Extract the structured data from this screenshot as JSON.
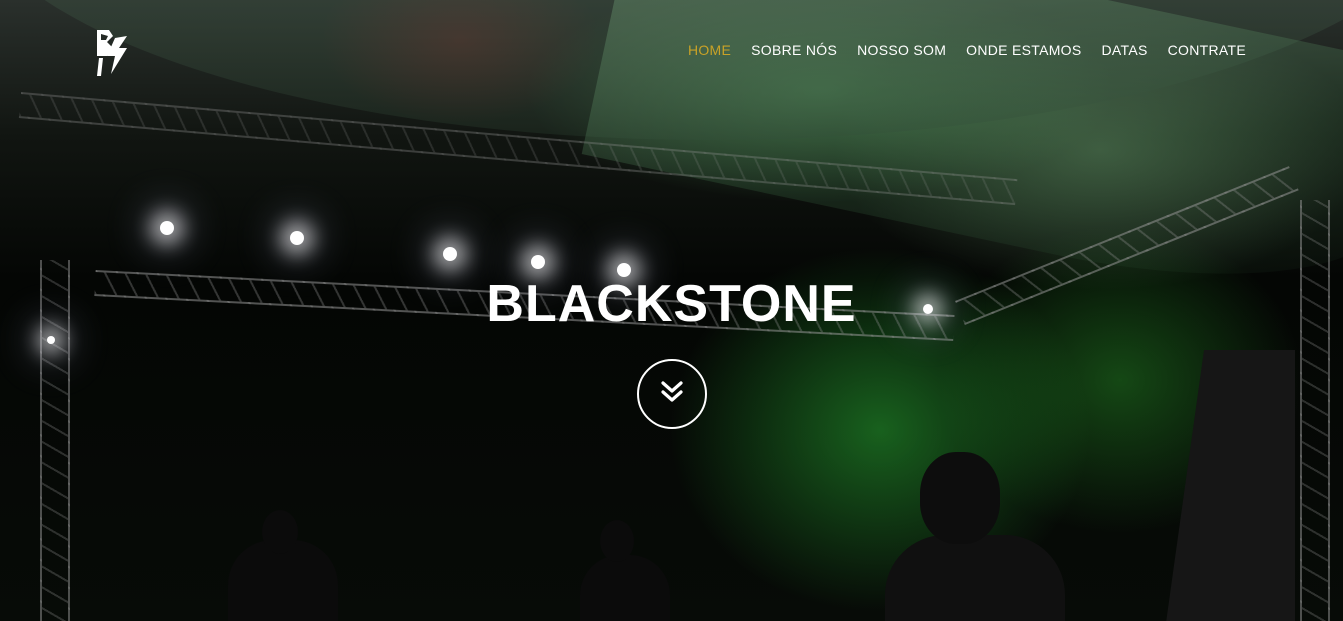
{
  "brand": {
    "logo_icon": "blackstone-lightning-logo"
  },
  "nav": {
    "items": [
      {
        "label": "HOME",
        "active": true
      },
      {
        "label": "SOBRE NÓS",
        "active": false
      },
      {
        "label": "NOSSO SOM",
        "active": false
      },
      {
        "label": "ONDE ESTAMOS",
        "active": false
      },
      {
        "label": "DATAS",
        "active": false
      },
      {
        "label": "CONTRATE",
        "active": false
      }
    ],
    "active_color": "#c9a227",
    "text_color": "#ffffff"
  },
  "hero": {
    "title": "BLACKSTONE",
    "scroll_icon": "double-chevron-down-icon"
  }
}
